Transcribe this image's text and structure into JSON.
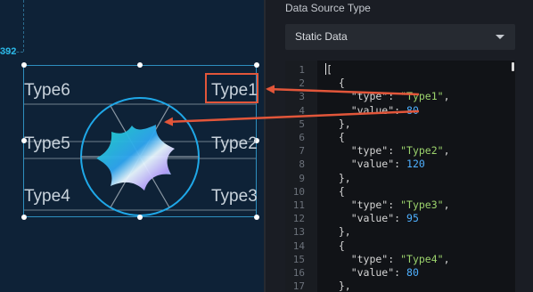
{
  "canvas": {
    "coord_label": "392",
    "radar_labels": [
      "Type1",
      "Type2",
      "Type3",
      "Type4",
      "Type5",
      "Type6"
    ],
    "colors": {
      "widget_border": "#2e8fbf",
      "radar_circle": "#1fa8e8",
      "highlight": "#e2563a",
      "label": "#c9d3dc"
    }
  },
  "panel": {
    "section_title": "Data Source Type",
    "source_select": {
      "value": "Static Data",
      "icon": "chevron-down-icon"
    },
    "editor": {
      "line_numbers": [
        "1",
        "2",
        "3",
        "4",
        "5",
        "6",
        "7",
        "8",
        "9",
        "10",
        "11",
        "12",
        "13",
        "14",
        "15",
        "16",
        "17"
      ],
      "lines": [
        [
          {
            "t": "[",
            "c": "k"
          }
        ],
        [
          {
            "t": "  {",
            "c": "k"
          }
        ],
        [
          {
            "t": "    \"type\": ",
            "c": "k"
          },
          {
            "t": "\"Type1\"",
            "c": "s"
          },
          {
            "t": ",",
            "c": "k"
          }
        ],
        [
          {
            "t": "    \"value\": ",
            "c": "k"
          },
          {
            "t": "80",
            "c": "n"
          }
        ],
        [
          {
            "t": "  },",
            "c": "k"
          }
        ],
        [
          {
            "t": "  {",
            "c": "k"
          }
        ],
        [
          {
            "t": "    \"type\": ",
            "c": "k"
          },
          {
            "t": "\"Type2\"",
            "c": "s"
          },
          {
            "t": ",",
            "c": "k"
          }
        ],
        [
          {
            "t": "    \"value\": ",
            "c": "k"
          },
          {
            "t": "120",
            "c": "n"
          }
        ],
        [
          {
            "t": "  },",
            "c": "k"
          }
        ],
        [
          {
            "t": "  {",
            "c": "k"
          }
        ],
        [
          {
            "t": "    \"type\": ",
            "c": "k"
          },
          {
            "t": "\"Type3\"",
            "c": "s"
          },
          {
            "t": ",",
            "c": "k"
          }
        ],
        [
          {
            "t": "    \"value\": ",
            "c": "k"
          },
          {
            "t": "95",
            "c": "n"
          }
        ],
        [
          {
            "t": "  },",
            "c": "k"
          }
        ],
        [
          {
            "t": "  {",
            "c": "k"
          }
        ],
        [
          {
            "t": "    \"type\": ",
            "c": "k"
          },
          {
            "t": "\"Type4\"",
            "c": "s"
          },
          {
            "t": ",",
            "c": "k"
          }
        ],
        [
          {
            "t": "    \"value\": ",
            "c": "k"
          },
          {
            "t": "80",
            "c": "n"
          }
        ],
        [
          {
            "t": "  },",
            "c": "k"
          }
        ]
      ]
    }
  }
}
